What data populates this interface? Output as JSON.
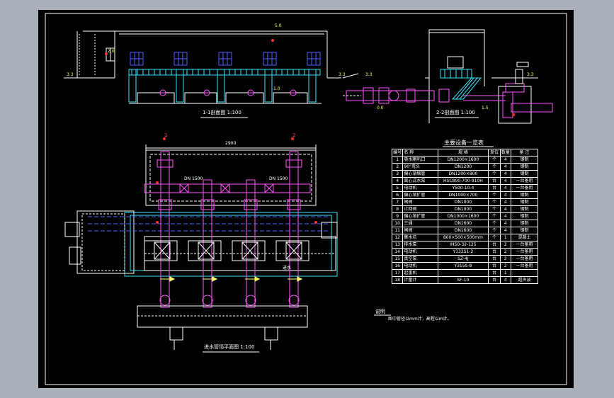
{
  "drawing": {
    "section_1_title": "1-1剖面图 1:100",
    "section_2_title": "2-2剖面图 1:100",
    "plan_title": "进水管场平面图 1:100",
    "table_title": "主要设备一览表",
    "notes_heading": "说明",
    "notes_text": "图中管径以mm计，高程以m计。",
    "elev_labels": [
      "3.3",
      "5.0",
      "3.3",
      "1.0",
      "3.3",
      "0.0",
      "1.5",
      "3.3",
      "2.0"
    ],
    "dims": {
      "plan_width": "2900",
      "pipe_dn1": "DN 1500",
      "pipe_dn2": "DN 1500",
      "flow_note": "进水"
    },
    "markers": {
      "section_mark_1": "1",
      "section_mark_2": "2"
    }
  },
  "equipment_table": {
    "headers": [
      "编号",
      "名 称",
      "规 格",
      "单位",
      "数量",
      "备 注"
    ],
    "rows": [
      [
        "1",
        "吸水喇叭口",
        "DN1200×1600",
        "个",
        "4",
        "钢制"
      ],
      [
        "2",
        "90°弯头",
        "DN1200",
        "个",
        "4",
        "钢制"
      ],
      [
        "3",
        "偏心渐缩管",
        "DN1200×800",
        "个",
        "4",
        "钢制"
      ],
      [
        "4",
        "离心式水泵",
        "HSC800-700-910H",
        "台",
        "4",
        "一台备用"
      ],
      [
        "5",
        "电动机",
        "Y500-10-4",
        "台",
        "4",
        "一台备用"
      ],
      [
        "6",
        "偏心渐扩管",
        "DN1000×700",
        "个",
        "4",
        "钢制"
      ],
      [
        "7",
        "闸阀",
        "DN1000",
        "个",
        "4",
        "钢制"
      ],
      [
        "8",
        "止回阀",
        "DN1000",
        "个",
        "4",
        "钢制"
      ],
      [
        "9",
        "偏心渐扩管",
        "DN1000×1600",
        "个",
        "4",
        "钢制"
      ],
      [
        "10",
        "三通",
        "DN1600",
        "个",
        "4",
        "钢制"
      ],
      [
        "11",
        "闸阀",
        "DN1600",
        "个",
        "4",
        "钢制"
      ],
      [
        "12",
        "集水坑",
        "800×500×500mm",
        "个",
        "1",
        "混凝土"
      ],
      [
        "13",
        "排水泵",
        "IH50-32-125",
        "台",
        "2",
        "一台备用"
      ],
      [
        "14",
        "电动机",
        "Y132S1-2",
        "台",
        "2",
        "一台备用"
      ],
      [
        "15",
        "真空泵",
        "SZ-4J",
        "台",
        "2",
        "一台备用"
      ],
      [
        "16",
        "电动机",
        "Y315S-8",
        "台",
        "2",
        "一台备用"
      ],
      [
        "17",
        "起重机",
        "",
        "台",
        "1",
        ""
      ],
      [
        "18",
        "计量计",
        "SF-10",
        "台",
        "4",
        "超声波"
      ]
    ]
  },
  "colors": {
    "background": "#000000",
    "frame": "#ffffff",
    "pipe": "#ff55ff",
    "wall": "#39e6ff",
    "accent": "#ffff66",
    "marker": "#ff3030",
    "window": "#5060ff",
    "outer": "#a9b0ba"
  }
}
